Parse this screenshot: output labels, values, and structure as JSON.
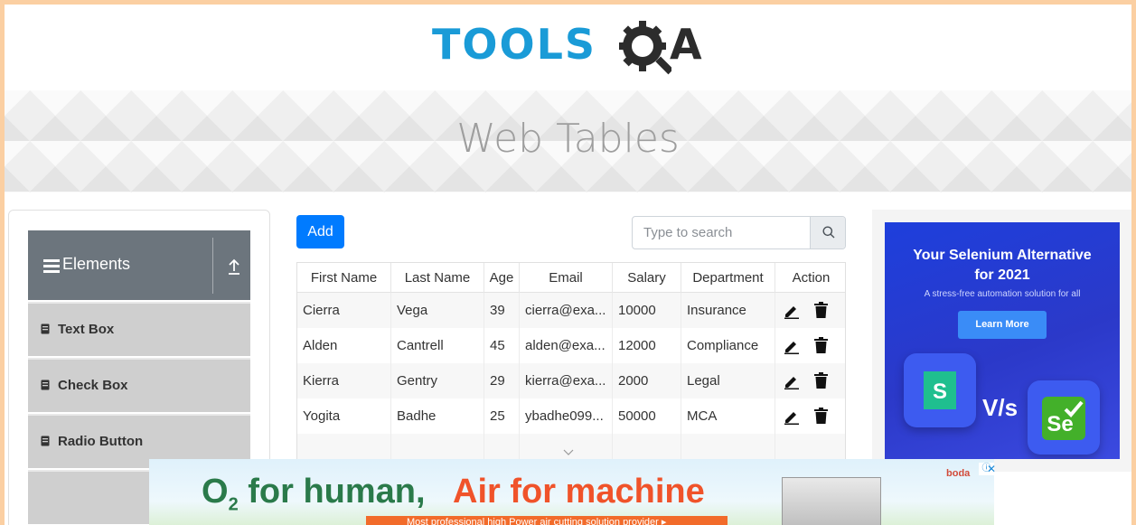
{
  "header": {
    "logo_text": "TOOLS",
    "logo_suffix": "A",
    "logo_icon": "gear-magnifier-icon"
  },
  "banner": {
    "title": "Web Tables"
  },
  "sidebar": {
    "group_title": "Elements",
    "items": [
      {
        "label": "Text Box"
      },
      {
        "label": "Check Box"
      },
      {
        "label": "Radio Button"
      }
    ]
  },
  "toolbar": {
    "add_label": "Add",
    "search_placeholder": "Type to search"
  },
  "table": {
    "headers": [
      "First Name",
      "Last Name",
      "Age",
      "Email",
      "Salary",
      "Department",
      "Action"
    ],
    "rows": [
      {
        "first": "Cierra",
        "last": "Vega",
        "age": "39",
        "email": "cierra@exa...",
        "salary": "10000",
        "dept": "Insurance"
      },
      {
        "first": "Alden",
        "last": "Cantrell",
        "age": "45",
        "email": "alden@exa...",
        "salary": "12000",
        "dept": "Compliance"
      },
      {
        "first": "Kierra",
        "last": "Gentry",
        "age": "29",
        "email": "kierra@exa...",
        "salary": "2000",
        "dept": "Legal"
      },
      {
        "first": "Yogita",
        "last": "Badhe",
        "age": "25",
        "email": "ybadhe099...",
        "salary": "50000",
        "dept": "MCA"
      }
    ]
  },
  "right_ad": {
    "headline_1": "Your Selenium Alternative",
    "headline_2": "for 2021",
    "subtext": "A stress-free automation solution for all",
    "button": "Learn More",
    "vs": "V/s",
    "left_logo": "S",
    "right_logo": "Se"
  },
  "bottom_ad": {
    "left_text": "O",
    "left_sub": "2",
    "left_rest": " for human,",
    "right_text": "Air for machine",
    "strip": "Most professional high Power air cutting solution provider ▸",
    "brand": "boda"
  },
  "colors": {
    "primary": "#007bff",
    "sidebar_header": "#6c757d",
    "logo_blue": "#1a9bd7",
    "page_border": "#fbcfa2"
  }
}
